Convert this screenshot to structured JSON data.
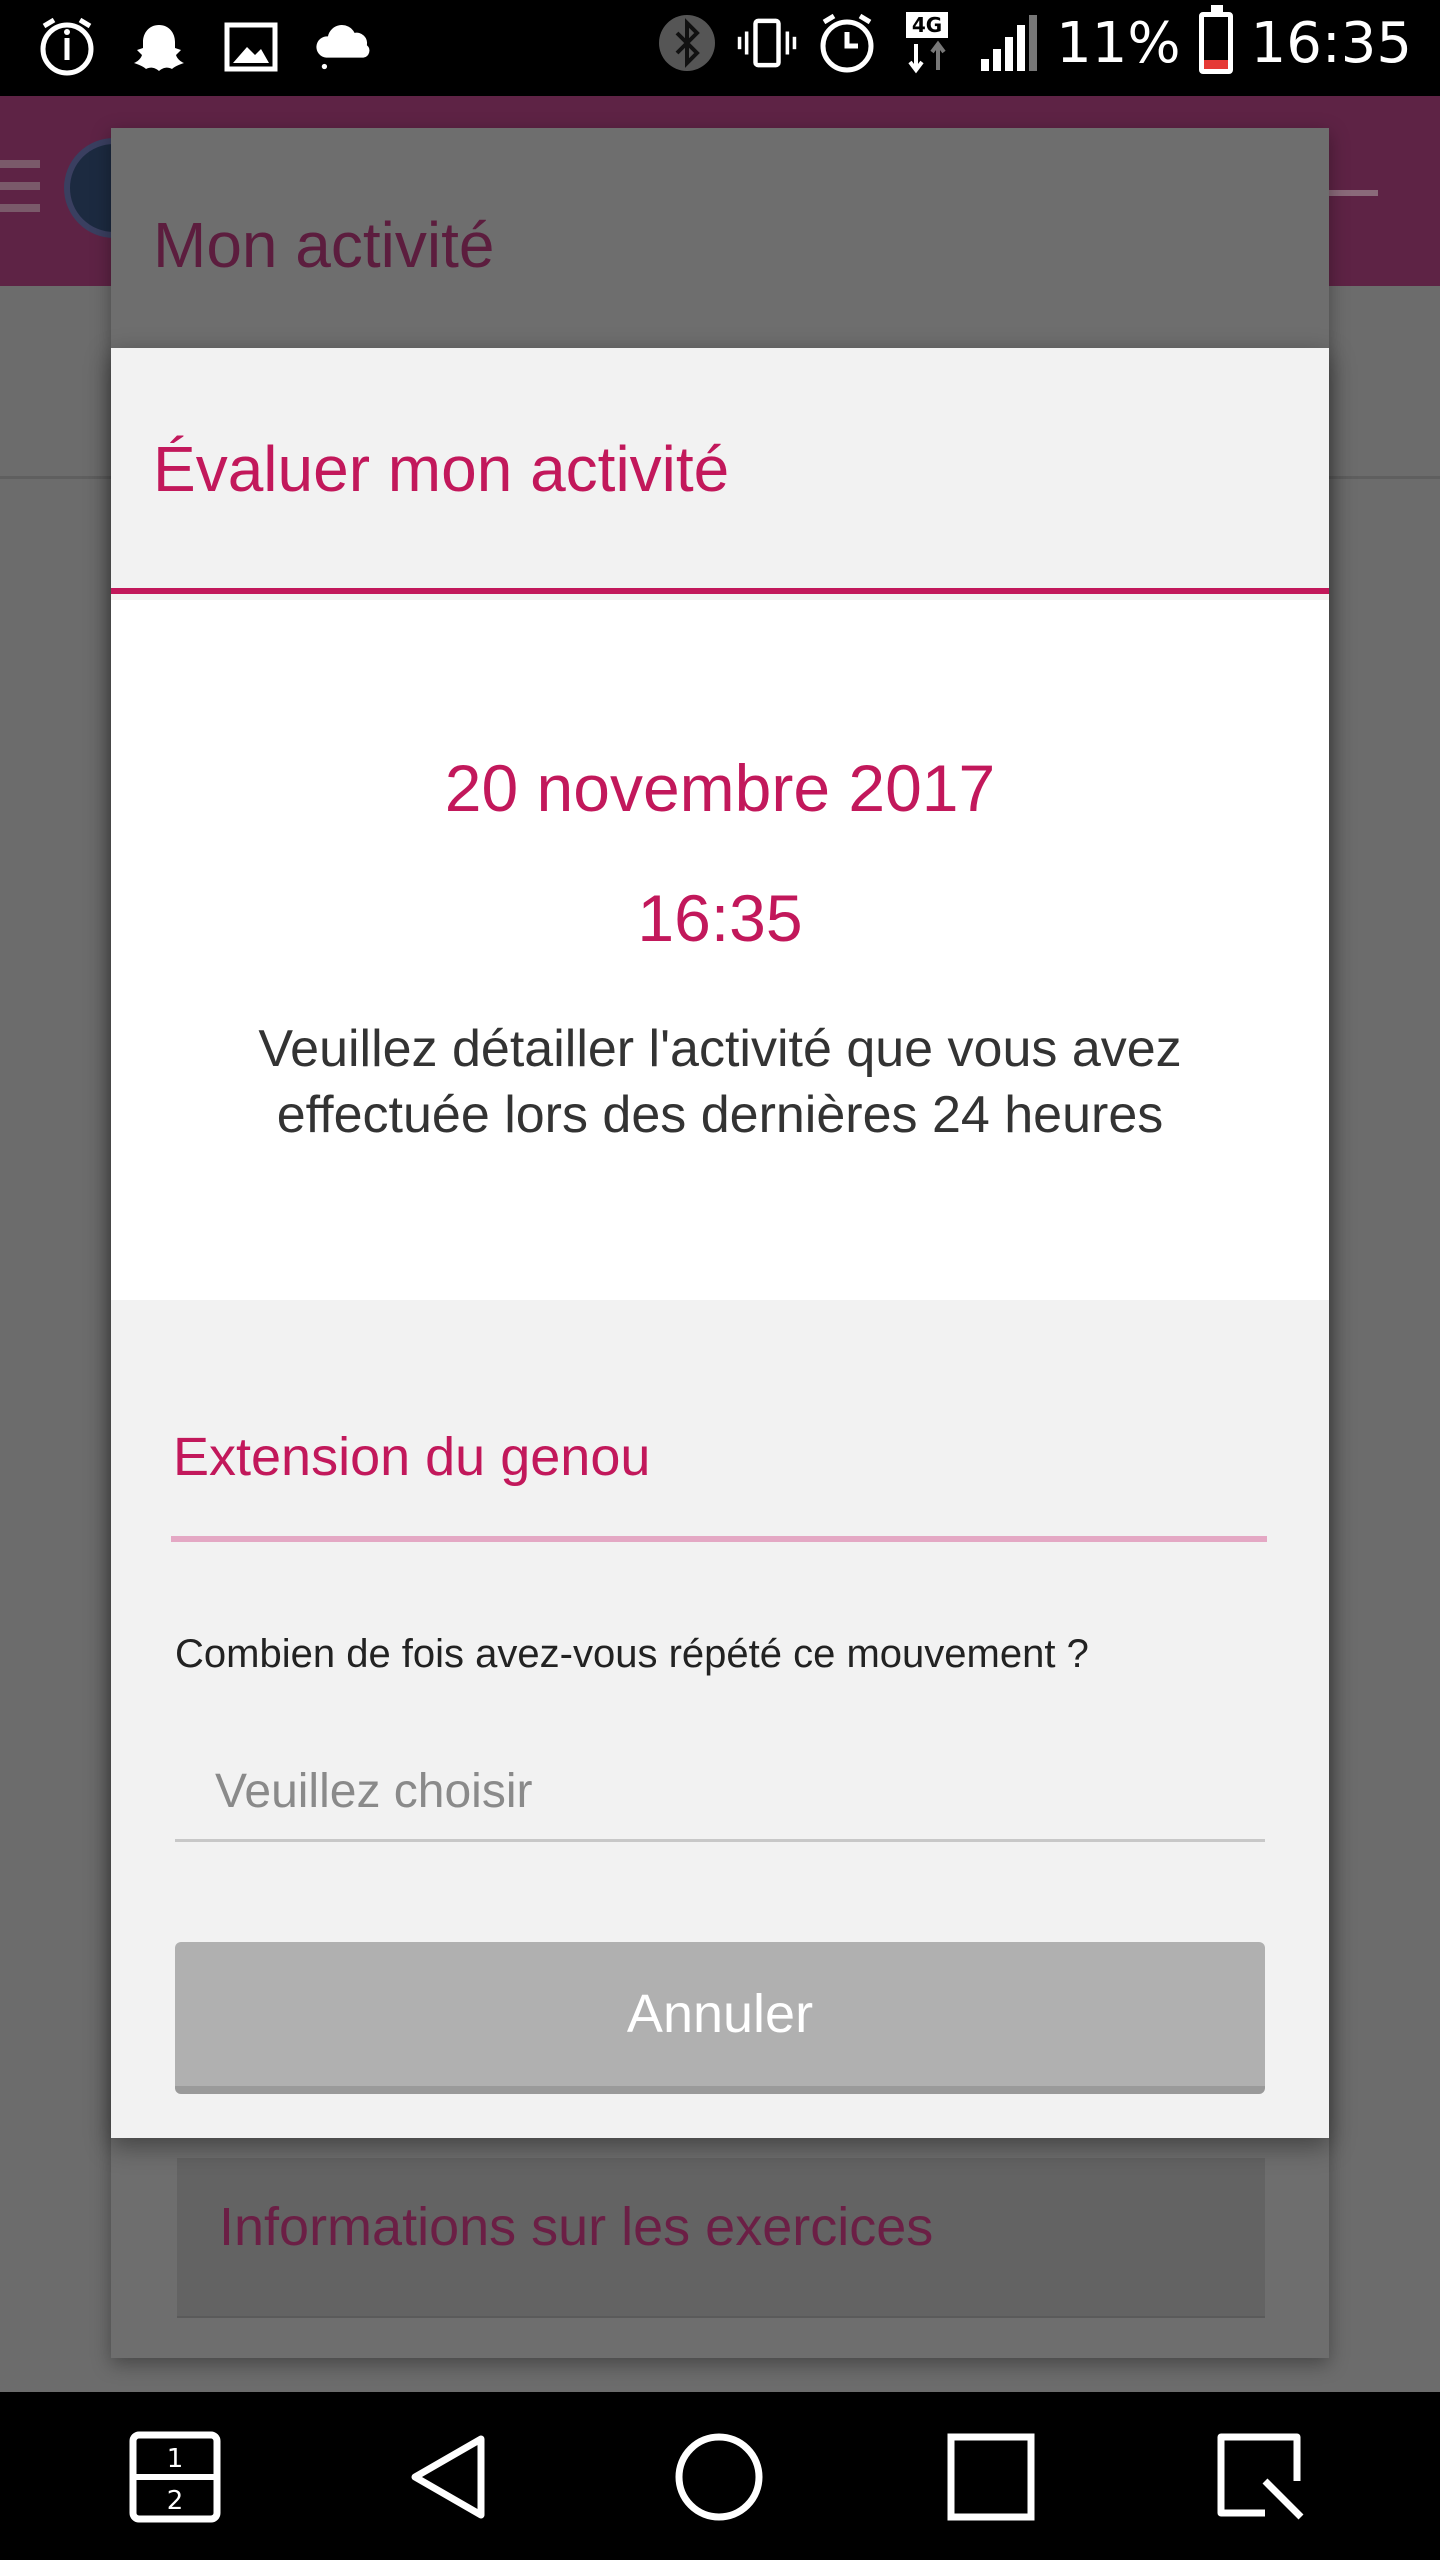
{
  "status_bar": {
    "battery_percent": "11%",
    "time": "16:35",
    "network": "4G",
    "left_icons": [
      "alarm-info-icon",
      "snapchat-icon",
      "gallery-icon",
      "cloud-icon"
    ],
    "right_icons": [
      "bluetooth-icon",
      "vibrate-icon",
      "alarm-icon",
      "4g-data-icon",
      "signal-icon",
      "battery-icon"
    ]
  },
  "background": {
    "panel_title": "Mon activité",
    "info_link": "Informations sur les exercices"
  },
  "dialog": {
    "title": "Évaluer mon activité",
    "date": "20 novembre 2017",
    "time": "16:35",
    "description": "Veuillez détailler l'activité que vous avez effectuée lors des dernières 24 heures",
    "exercise_title": "Extension du genou",
    "question": "Combien de fois avez-vous répété ce mouvement ?",
    "select_placeholder": "Veuillez choisir",
    "cancel_label": "Annuler"
  },
  "nav_bar": {
    "buttons": [
      "dual-window-icon",
      "back-icon",
      "home-icon",
      "recents-icon",
      "capture-icon"
    ],
    "dual_window_numbers": [
      "1",
      "2"
    ]
  },
  "colors": {
    "accent": "#c2185b",
    "status_bar": "#000000",
    "button_disabled": "#b0b0b0"
  }
}
